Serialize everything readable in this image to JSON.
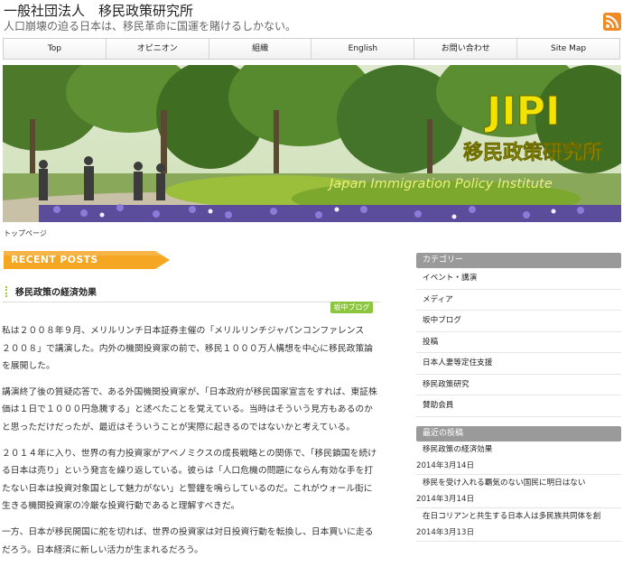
{
  "site": {
    "title": "一般社団法人　移民政策研究所",
    "tagline": "人口崩壊の迫る日本は、移民革命に国運を賭けるしかない。"
  },
  "nav": [
    "Top",
    "オピニオン",
    "組織",
    "English",
    "お問い合わせ",
    "Site Map"
  ],
  "banner": {
    "logo": "JIPI",
    "name_ja": "移民政策研究所",
    "name_en": "Japan Immigration Policy Institute"
  },
  "breadcrumb": "トップページ",
  "recent_posts_heading": "RECENT POSTS",
  "post": {
    "title": "移民政策の経済効果",
    "category": "坂中ブログ",
    "paragraphs": [
      "私は２００８年９月、メリルリンチ日本証券主催の「メリルリンチジャパンコンファレンス　２００８」で講演した。内外の機関投資家の前で、移民１０００万人構想を中心に移民政策論を展開した。",
      "講演終了後の質疑応答で、ある外国機関投資家が、「日本政府が移民国家宣言をすれば、東証株価は１日で１０００円急騰する」と述べたことを覚えている。当時はそういう見方もあるのかと思っただけだったが、最近はそういうことが実際に起きるのではないかと考えている。",
      "２０１４年に入り、世界の有力投資家がアベノミクスの成長戦略との関係で、「移民鎖国を続ける日本は売り」という発言を繰り返している。彼らは「人口危機の問題にならん有効な手を打たない日本は投資対象国として魅力がない」と警鐘を鳴らしているのだ。これがウォール街に生きる機関投資家の冷厳な投資行動であると理解すべきだ。",
      "一方、日本が移民開国に舵を切れば、世界の投資家は対日投資行動を転換し、日本買いに走るだろう。日本経済に新しい活力が生まれるだろう。"
    ]
  },
  "sidebar": {
    "categories_heading": "カテゴリー",
    "categories": [
      "イベント・講演",
      "メディア",
      "坂中ブログ",
      "投稿",
      "日本人妻等定住支援",
      "移民政策研究",
      "賛助会員"
    ],
    "recent_heading": "最近の投稿",
    "recent": [
      {
        "title": "移民政策の経済効果",
        "date": "2014年3月14日"
      },
      {
        "title": "移民を受け入れる覇気のない国民に明日はない",
        "date": "2014年3月14日"
      },
      {
        "title": "在日コリアンと共生する日本人は多民族共同体を創",
        "date": "2014年3月13日"
      }
    ]
  },
  "colors": {
    "accent_orange": "#f5a623",
    "category_badge": "#8cc63e",
    "sidebar_header": "#9a9a9a",
    "logo_yellow": "#f2e400"
  }
}
